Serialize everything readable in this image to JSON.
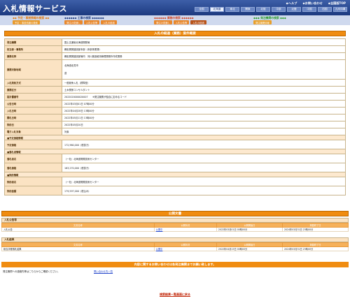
{
  "header": {
    "logo": "入札情報サービス",
    "top_links": [
      "ヘルプ",
      "お問い合わせ",
      "全国版TOP"
    ],
    "regions_row1": [
      "北海道",
      "東北",
      "関東",
      "北陸",
      "中部",
      "近畿"
    ],
    "regions_row2": [
      "全国",
      "北海道",
      "東北",
      "関東",
      "北陸",
      "中部",
      "近畿",
      "中国",
      "四国",
      "九州沖縄"
    ],
    "selected_region": "北海道"
  },
  "nav": {
    "groups": [
      {
        "title": "◆◆ 予定・事前情報の検索 ◆◆",
        "color": "#e07a10",
        "buttons": [
          "予定・事前情報の検索"
        ]
      },
      {
        "title": "◆◆◆◆◆◆ 工事の検索 ◆◆◆◆◆◆",
        "color": "#d14a2a",
        "buttons": [
          "発注の見通し",
          "入札公告等",
          "入札の経過"
        ]
      },
      {
        "title": "◆◆◆◆◆◆ 業務の検索 ◆◆◆◆◆◆",
        "color": "#e07a10",
        "buttons": [
          "発注の見通し",
          "入札公告等",
          "入札の経過"
        ]
      },
      {
        "title": "◆◆◆ 発注機関の検索 ◆◆◆",
        "color": "#2a9a2a",
        "buttons": [
          "発注機関情報"
        ]
      }
    ],
    "active": "入札の経過"
  },
  "page_title": "入札の経過（業務）案件概要",
  "detail": [
    {
      "label": "発注機関",
      "value": "国土交通省北海道開発局"
    },
    {
      "label": "担当部・事務所",
      "value": "網走開発建設部本部（本部事業課）"
    },
    {
      "label": "業務名称",
      "value": "網走開発建設部管内　河川施設維持管理業務外作成業務"
    },
    {
      "label": "業務対象地域",
      "value": "北海道北見市",
      "value2": "道"
    },
    {
      "label": "入札契約方式",
      "value": "一般競争入札（標準型）"
    },
    {
      "label": "業務区分",
      "value": "土木関係コンサルタント"
    },
    {
      "label": "設計書番号",
      "value": "2022020000020007　　※発注機関が独自に定めるコード"
    },
    {
      "label": "公告日時",
      "value": "2022年03月01日 07時00分"
    },
    {
      "label": "入札日時",
      "value": "2022年04月28日 13時00分"
    },
    {
      "label": "開札日時",
      "value": "2022年05月11日 13時00分"
    },
    {
      "label": "契約日",
      "value": "2022年05月20日"
    },
    {
      "label": "電子入札対象",
      "value": "対象"
    }
  ],
  "sections": {
    "planned": "■予定価格情報",
    "planned_price_label": "予定価格",
    "planned_price": "172,960,000（税抜き）",
    "winner": "■落札者情報",
    "winner_name_label": "落札者名",
    "winner_name": "（一社）北海道開発技術センター",
    "winner_price_label": "落札価格",
    "winner_price": "163,270,000（税抜き）",
    "contract": "■契約情報",
    "contractor_label": "契約者名",
    "contractor": "（一社）北海道開発技術センター",
    "contract_amount_label": "契約金額",
    "contract_amount": "179,597,000（税込み）"
  },
  "published": {
    "title": "公開文書",
    "columns": [
      "文書名称",
      "公開状況",
      "公開開始日",
      "掲載終了日"
    ],
    "groups": [
      {
        "name": "入札公告等",
        "rows": [
          {
            "doc": "入札公告",
            "status": "公開中",
            "start": "2022年03月01日 00時00分",
            "end": "2024年03月31日 23時00分"
          }
        ]
      },
      {
        "name": "入札結果",
        "rows": [
          {
            "doc": "総合評価落札結果",
            "status": "公開中",
            "start": "2022年04月15日 00時00分",
            "end": "2024年03月31日 23時00分"
          }
        ]
      }
    ]
  },
  "inquiry": {
    "bar": "内容に関するお問い合わせは各発注機関までお願い致します。",
    "text": "発注機関への連絡先等はこちらからご確認ください。",
    "link": "問い合わせ先一覧"
  },
  "back_link": "検索結果一覧画面に戻る"
}
